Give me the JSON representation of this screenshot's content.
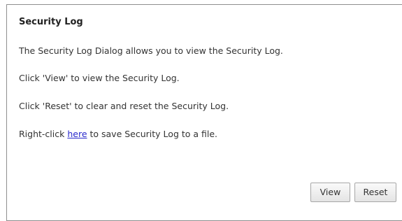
{
  "panel": {
    "title": "Security Log",
    "description": "The Security Log Dialog allows you to view the Security Log.",
    "view_help": "Click 'View' to view the Security Log.",
    "reset_help": "Click 'Reset' to clear and reset the Security Log.",
    "save_prefix": "Right-click ",
    "save_link": "here",
    "save_suffix": " to save Security Log to a file."
  },
  "buttons": {
    "view_label": "View",
    "reset_label": "Reset"
  }
}
